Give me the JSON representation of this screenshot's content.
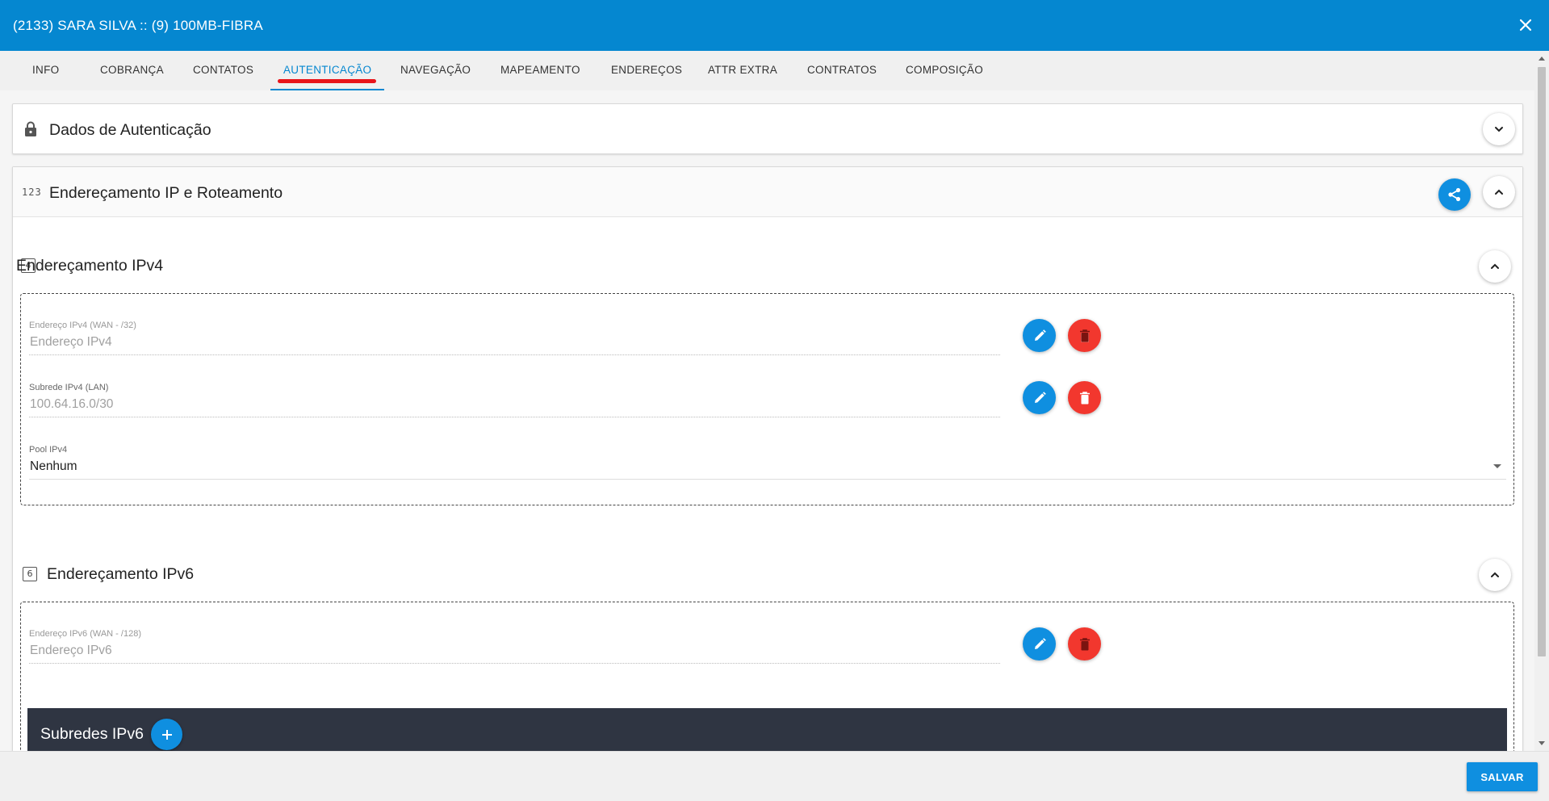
{
  "window": {
    "title": "(2133) SARA SILVA :: (9) 100MB-FIBRA"
  },
  "tabs": [
    {
      "label": "INFO"
    },
    {
      "label": "COBRANÇA"
    },
    {
      "label": "CONTATOS"
    },
    {
      "label": "AUTENTICAÇÃO"
    },
    {
      "label": "NAVEGAÇÃO"
    },
    {
      "label": "MAPEAMENTO"
    },
    {
      "label": "ENDEREÇOS"
    },
    {
      "label": "ATTR EXTRA"
    },
    {
      "label": "CONTRATOS"
    },
    {
      "label": "COMPOSIÇÃO"
    }
  ],
  "active_tab": "AUTENTICAÇÃO",
  "auth_panel": {
    "title": "Dados de Autenticação"
  },
  "ip_panel": {
    "title": "Endereçamento IP e Roteamento",
    "icon_text": "123",
    "ipv4": {
      "title": "Endereçamento IPv4",
      "icon_text": "4",
      "wan_label": "Endereço IPv4 (WAN - /32)",
      "wan_value": "Endereço IPv4",
      "lan_label": "Subrede IPv4 (LAN)",
      "lan_value": "100.64.16.0/30",
      "pool_label": "Pool IPv4",
      "pool_value": "Nenhum"
    },
    "ipv6": {
      "title": "Endereçamento IPv6",
      "icon_text": "6",
      "wan_label": "Endereço IPv6 (WAN - /128)",
      "wan_value": "Endereço IPv6",
      "subnets_label": "Subredes IPv6"
    }
  },
  "footer": {
    "save_label": "SALVAR"
  },
  "colors": {
    "header": "#0587d0",
    "accent": "#0f8fe0",
    "danger": "#f2372e",
    "dark_bar": "#2f3542",
    "annotation_underline": "#e8141a"
  }
}
